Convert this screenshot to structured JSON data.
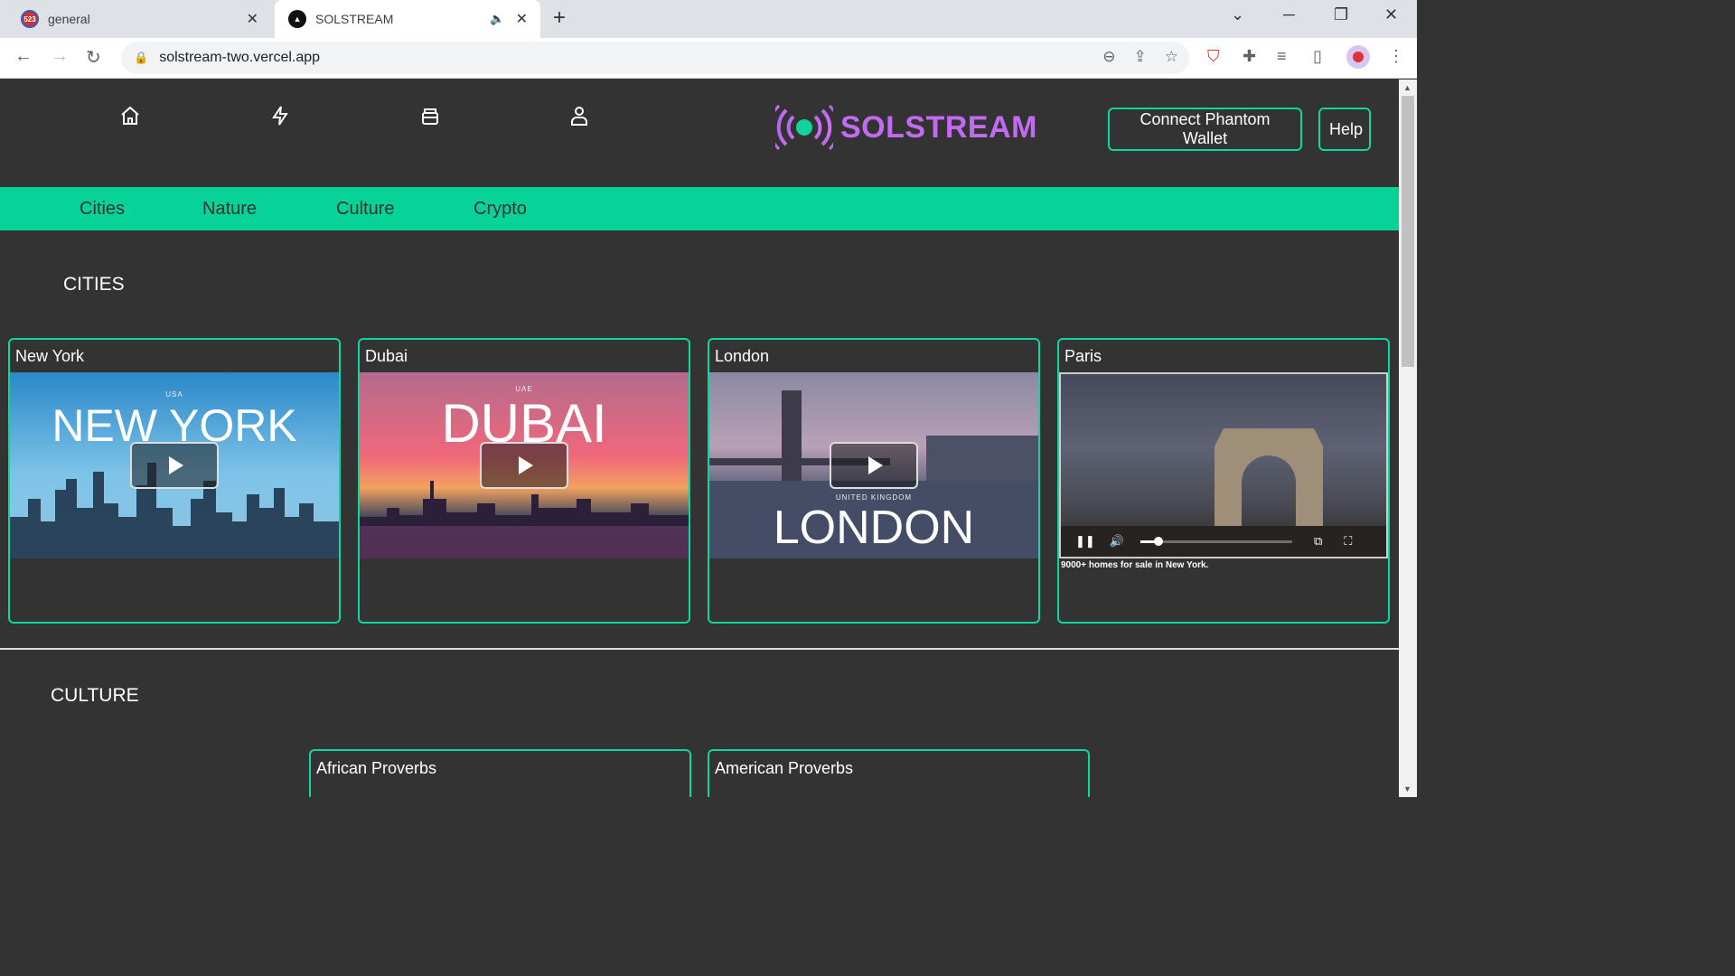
{
  "browser": {
    "tabs": [
      {
        "title": "general",
        "favicon": "calendar-523-icon",
        "favicon_text": "523"
      },
      {
        "title": "SOLSTREAM",
        "favicon": "vercel-icon",
        "audio": true
      }
    ],
    "url": "solstream-two.vercel.app"
  },
  "header": {
    "nav_icons": [
      "home-icon",
      "lightning-icon",
      "wallet-icon",
      "user-icon"
    ],
    "logo_text": "SOLSTREAM",
    "connect_button": "Connect Phantom Wallet",
    "help_button": "Help"
  },
  "categories": [
    "Cities",
    "Nature",
    "Culture",
    "Crypto"
  ],
  "sections": {
    "cities": {
      "title": "CITIES",
      "cards": [
        {
          "title": "New York",
          "thumb_small": "USA",
          "thumb_big": "NEW YORK"
        },
        {
          "title": "Dubai",
          "thumb_small": "UAE",
          "thumb_big": "DUBAI"
        },
        {
          "title": "London",
          "thumb_small": "UNITED KINGDOM",
          "thumb_big": "LONDON"
        },
        {
          "title": "Paris",
          "caption": "9000+ homes for sale in New York.",
          "video_progress": 0.12
        }
      ]
    },
    "culture": {
      "title": "CULTURE",
      "cards": [
        {
          "title": "African Proverbs"
        },
        {
          "title": "American Proverbs"
        }
      ]
    }
  },
  "colors": {
    "accent": "#07d398",
    "logo": "#c36af3",
    "background": "#333333"
  }
}
